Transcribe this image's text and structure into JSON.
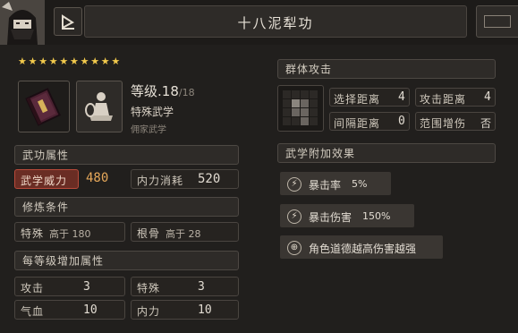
{
  "title": "十八泥犁功",
  "stars": 10,
  "level": {
    "label": "等级",
    "value": ".18",
    "max": "/18"
  },
  "category": "特殊武学",
  "faction": "佣家武学",
  "attributes": {
    "header": "武功属性",
    "power_label": "武学威力",
    "power_value": "480",
    "cost_label": "内力消耗",
    "cost_value": "520"
  },
  "requirements": {
    "header": "修炼条件",
    "items": [
      {
        "label": "特殊",
        "text": "高于 180"
      },
      {
        "label": "根骨",
        "text": "高于 28"
      }
    ]
  },
  "per_level": {
    "header": "每等级增加属性",
    "items": [
      {
        "label": "攻击",
        "value": "3"
      },
      {
        "label": "特殊",
        "value": "3"
      },
      {
        "label": "气血",
        "value": "10"
      },
      {
        "label": "内力",
        "value": "10"
      }
    ]
  },
  "area_attack": {
    "header": "群体攻击",
    "stats": [
      {
        "label": "选择距离",
        "value": "4"
      },
      {
        "label": "攻击距离",
        "value": "4"
      },
      {
        "label": "间隔距离",
        "value": "0"
      },
      {
        "label": "范围增伤",
        "value": "否"
      }
    ]
  },
  "effects": {
    "header": "武学附加效果",
    "items": [
      {
        "name": "暴击率",
        "value": "5%",
        "icon": "lightning-icon"
      },
      {
        "name": "暴击伤害",
        "value": "150%",
        "icon": "lightning-icon"
      },
      {
        "name": "角色道德越高伤害越强",
        "value": "",
        "icon": "target-icon"
      }
    ]
  },
  "colors": {
    "accent": "#f2c94c",
    "power_highlight": "#e6a85a",
    "power_border": "#b84a3a"
  }
}
